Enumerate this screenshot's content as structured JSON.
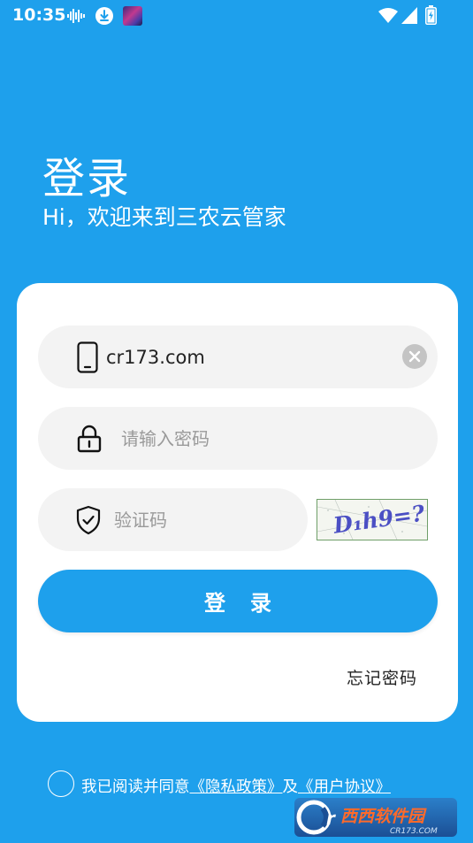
{
  "status_bar": {
    "time": "10:35",
    "icons": [
      "voice-icon",
      "download-icon",
      "app-icon",
      "wifi-icon",
      "signal-icon",
      "battery-icon"
    ]
  },
  "header": {
    "title": "登录",
    "subtitle": "Hi，欢迎来到三农云管家"
  },
  "form": {
    "phone_value": "cr173.com",
    "password_placeholder": "请输入密码",
    "captcha_placeholder": "验证码",
    "captcha_text": "D₁h9=?",
    "login_label": "登录",
    "forgot_label": "忘记密码"
  },
  "agreement": {
    "prefix": "我已阅读并同意",
    "privacy_link": "《隐私政策》",
    "conjunction": "及",
    "terms_link": "《用户协议》"
  },
  "watermark": {
    "brand": "西西软件园",
    "url": "CR173.COM"
  },
  "colors": {
    "primary": "#1ea0ec",
    "card": "#ffffff",
    "field_bg": "#f3f3f3",
    "placeholder": "#9a9a9a"
  }
}
